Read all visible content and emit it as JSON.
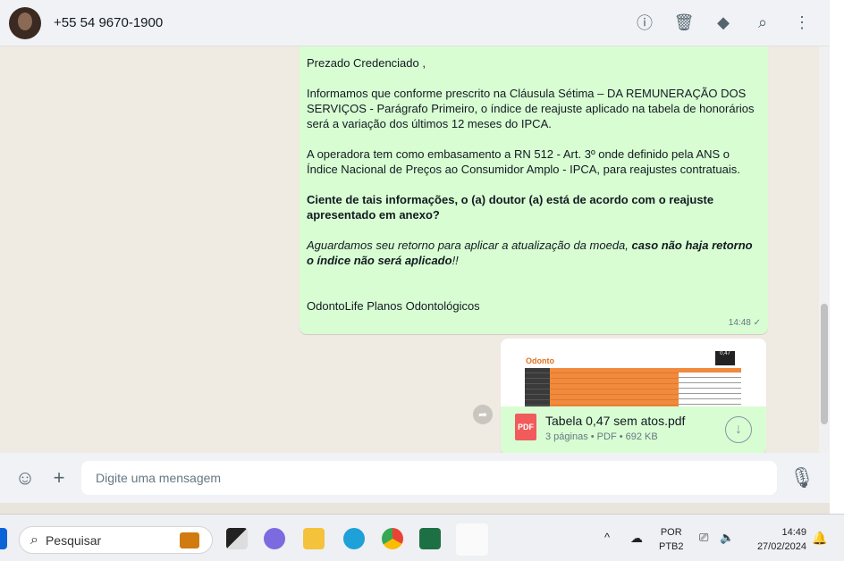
{
  "header": {
    "contact": "+55 54 9670-1900",
    "icons": [
      "info-icon",
      "trash-icon",
      "label-icon",
      "search-icon",
      "more-vertical-icon"
    ]
  },
  "message": {
    "greeting": "Prezado Credenciado ,",
    "p1": "Informamos que conforme prescrito na Cláusula Sétima – DA REMUNERAÇÃO DOS SERVIÇOS - Parágrafo Primeiro, o índice de reajuste aplicado na tabela de honorários será a variação dos últimos 12 meses do IPCA.",
    "p2": "A operadora tem como embasamento a RN 512 - Art. 3º onde definido pela ANS o Índice Nacional de Preços ao Consumidor Amplo - IPCA, para reajustes contratuais.",
    "p3": "Ciente de tais informações, o (a) doutor (a) está de acordo com o reajuste apresentado em anexo?",
    "p4_italic": "Aguardamos seu retorno para aplicar a atualização da moeda, ",
    "p4_bold": "caso não haja retorno o índice não será aplicado",
    "p4_end": "!!",
    "signature": "OdontoLife Planos Odontológicos",
    "time": "14:48",
    "status": "✓"
  },
  "document": {
    "name": "Tabela 0,47 sem atos.pdf",
    "meta": "3 páginas • PDF • 692 KB",
    "type_label": "PDF",
    "preview_logo": "Odonto",
    "preview_badge": "0,47"
  },
  "composer": {
    "placeholder": "Digite uma mensagem"
  },
  "taskbar": {
    "search": "Pesquisar",
    "lang1": "POR",
    "lang2": "PTB2",
    "time": "14:49",
    "date": "27/02/2024"
  }
}
